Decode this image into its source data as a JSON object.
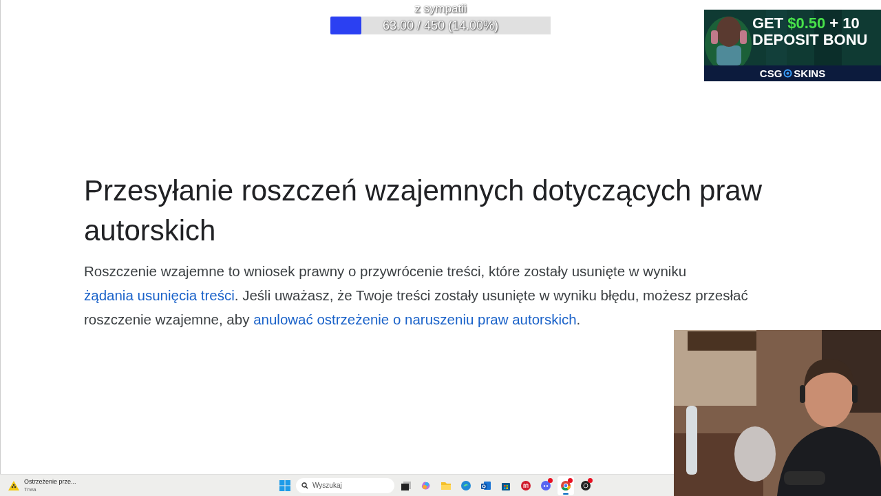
{
  "goal": {
    "label": "z sympatii",
    "reading": "63.00 / 450 (14.00%)",
    "level": 0.14
  },
  "ad": {
    "line_1": "GET",
    "amount": "$0.50",
    "line_1_end": "+ 10",
    "line_2": "DEPOSIT BONU",
    "brand_left": "CSG",
    "brand_right": "SKINS"
  },
  "article": {
    "title": "Przesyłanie roszczeń wzajemnych dotyczących praw autorskich",
    "paragraph": [
      {
        "kind": "text",
        "text": "Roszczenie wzajemne to wniosek prawny o przywrócenie treści, które zostały usunięte w wyniku "
      },
      {
        "kind": "link",
        "text": "żądania usunięcia treści"
      },
      {
        "kind": "text",
        "text": ". Jeśli uważasz, że Twoje treści zostały usunięte w wyniku błędu, możesz przesłać roszczenie wzajemne, aby "
      },
      {
        "kind": "link",
        "text": "anulować ostrzeżenie o naruszeniu praw autorskich"
      },
      {
        "kind": "text",
        "text": "."
      }
    ]
  },
  "taskbar": {
    "notification": {
      "title": "Ostrzeżenie prze...",
      "status": "Trwa"
    },
    "search": {
      "placeholder": "Wyszukaj"
    },
    "apps": [
      {
        "kind": "taskview",
        "selected": false,
        "badge": false
      },
      {
        "kind": "swirl",
        "selected": false,
        "badge": false
      },
      {
        "kind": "folder",
        "selected": false,
        "badge": false
      },
      {
        "kind": "wave",
        "selected": false,
        "badge": false
      },
      {
        "kind": "mail",
        "selected": false,
        "badge": false
      },
      {
        "kind": "bag",
        "selected": false,
        "badge": false
      },
      {
        "kind": "round",
        "selected": false,
        "badge": false
      },
      {
        "kind": "chat",
        "selected": false,
        "badge": true
      },
      {
        "kind": "chrome",
        "selected": true,
        "badge": true
      },
      {
        "kind": "dark",
        "selected": false,
        "badge": true
      }
    ]
  }
}
